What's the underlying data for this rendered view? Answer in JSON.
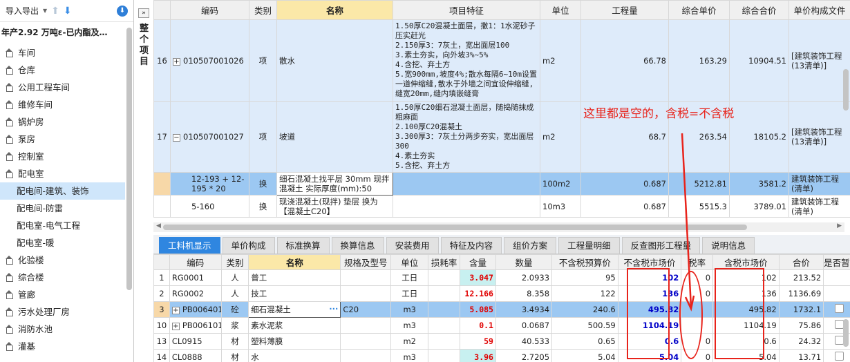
{
  "sidebar": {
    "import_export": "导入导出",
    "project_title": "年产2.92 万吨ε-已内酯及…",
    "items": [
      {
        "label": "车间",
        "sub": false
      },
      {
        "label": "仓库",
        "sub": false
      },
      {
        "label": "公用工程车间",
        "sub": false
      },
      {
        "label": "维修车间",
        "sub": false
      },
      {
        "label": "锅炉房",
        "sub": false
      },
      {
        "label": "泵房",
        "sub": false
      },
      {
        "label": "控制室",
        "sub": false
      },
      {
        "label": "配电室",
        "sub": false
      },
      {
        "label": "配电间-建筑、装饰",
        "sub": true
      },
      {
        "label": "配电间-防雷",
        "sub": true
      },
      {
        "label": "配电室-电气工程",
        "sub": true
      },
      {
        "label": "配电室-暖",
        "sub": true
      },
      {
        "label": "化验楼",
        "sub": false
      },
      {
        "label": "综合楼",
        "sub": false
      },
      {
        "label": "管廊",
        "sub": false
      },
      {
        "label": "污水处理厂房",
        "sub": false
      },
      {
        "label": "消防水池",
        "sub": false
      },
      {
        "label": "灌基",
        "sub": false
      }
    ]
  },
  "whole_project": "整个项目",
  "upper_table": {
    "headers": [
      "编码",
      "类别",
      "名称",
      "项目特征",
      "单位",
      "工程量",
      "综合单价",
      "综合合价",
      "单价构成文件"
    ],
    "rows": [
      {
        "no": "16",
        "code": "010507001026",
        "type": "项",
        "name": "散水",
        "feature": "1.50厚C20混凝土面层，撒1：1水泥砂子压实赶光\n2.150厚3：7灰土，宽出面层100\n3.素土夯实，向外坡3%~5%\n4.含挖、弃土方\n5.宽900mm,坡度4%;散水每隔6~10m设置一道伸缩缝,散水于外墙之间宜设伸缩缝,缝宽20mm,缝内填嵌缝膏",
        "unit": "m2",
        "qty": "66.78",
        "price": "163.29",
        "total": "10904.51",
        "file": "[建筑装饰工程(13清单)]"
      },
      {
        "no": "17",
        "code": "010507001027",
        "type": "项",
        "name": "坡道",
        "feature": "1.50厚C20细石混凝土面层，随捣随抹成粗麻面\n2.100厚C20混凝土\n3.300厚3：7灰土分两步夯实，宽出面层300\n4.素土夯实\n5.含挖、弃土方",
        "unit": "m2",
        "qty": "68.7",
        "price": "263.54",
        "total": "18105.2",
        "file": "[建筑装饰工程(13清单)]"
      },
      {
        "no": "",
        "code": "12-193 + 12-195 * 20",
        "type": "换",
        "name": "细石混凝土找平层 30mm 现拌混凝土  实际厚度(mm):50",
        "feature": "",
        "unit": "100m2",
        "qty": "0.687",
        "price": "5212.81",
        "total": "3581.2",
        "file": "建筑装饰工程(清单)"
      },
      {
        "no": "",
        "code": "5-160",
        "type": "换",
        "name": "现浇混凝土(现拌) 垫层   换为【混凝土C20】",
        "feature": "",
        "unit": "10m3",
        "qty": "0.687",
        "price": "5515.3",
        "total": "3789.01",
        "file": "建筑装饰工程(清单)"
      }
    ]
  },
  "tabs": [
    "工料机显示",
    "单价构成",
    "标准换算",
    "换算信息",
    "安装费用",
    "特征及内容",
    "组价方案",
    "工程量明细",
    "反查图形工程量",
    "说明信息"
  ],
  "lower_table": {
    "headers": [
      "编码",
      "类别",
      "名称",
      "规格及型号",
      "单位",
      "损耗率",
      "含量",
      "数量",
      "不含税预算价",
      "不含税市场价",
      "税率",
      "含税市场价",
      "合价",
      "是否暂估"
    ],
    "rows": [
      {
        "no": "1",
        "expand": false,
        "code": "RG0001",
        "type": "人",
        "name": "普工",
        "spec": "",
        "unit": "工日",
        "loss": "",
        "content": "3.047",
        "qty": "2.0933",
        "budget": "95",
        "market": "102",
        "tax": "0",
        "market_tax": "102",
        "total": "213.52",
        "check": false
      },
      {
        "no": "2",
        "expand": false,
        "code": "RG0002",
        "type": "人",
        "name": "技工",
        "spec": "",
        "unit": "工日",
        "loss": "",
        "content": "12.166",
        "qty": "8.358",
        "budget": "122",
        "market": "136",
        "tax": "0",
        "market_tax": "136",
        "total": "1136.69",
        "check": false
      },
      {
        "no": "3",
        "expand": true,
        "code": "PB006401",
        "type": "砼",
        "name": "细石混凝土",
        "spec": "C20",
        "unit": "m3",
        "loss": "",
        "content": "5.085",
        "qty": "3.4934",
        "budget": "240.6",
        "market": "495.82",
        "tax": "",
        "market_tax": "495.82",
        "total": "1732.1",
        "check": true
      },
      {
        "no": "10",
        "expand": true,
        "code": "PB006101",
        "type": "浆",
        "name": "素水泥浆",
        "spec": "",
        "unit": "m3",
        "loss": "",
        "content": "0.1",
        "qty": "0.0687",
        "budget": "500.59",
        "market": "1104.19",
        "tax": "",
        "market_tax": "1104.19",
        "total": "75.86",
        "check": true
      },
      {
        "no": "13",
        "expand": false,
        "code": "CL0915",
        "type": "材",
        "name": "塑料薄膜",
        "spec": "",
        "unit": "m2",
        "loss": "",
        "content": "59",
        "qty": "40.533",
        "budget": "0.65",
        "market": "0.6",
        "tax": "0",
        "market_tax": "0.6",
        "total": "24.32",
        "check": true
      },
      {
        "no": "14",
        "expand": false,
        "code": "CL0888",
        "type": "材",
        "name": "水",
        "spec": "",
        "unit": "m3",
        "loss": "",
        "content": "3.96",
        "qty": "2.7205",
        "budget": "5.04",
        "market": "5.04",
        "tax": "0",
        "market_tax": "5.04",
        "total": "13.71",
        "check": true
      }
    ]
  },
  "annotation": "这里都是空的，含税=不含税",
  "colors": {
    "accent": "#2f86e0",
    "annotation": "#e8231b",
    "selected_row": "#9cc8f2"
  }
}
